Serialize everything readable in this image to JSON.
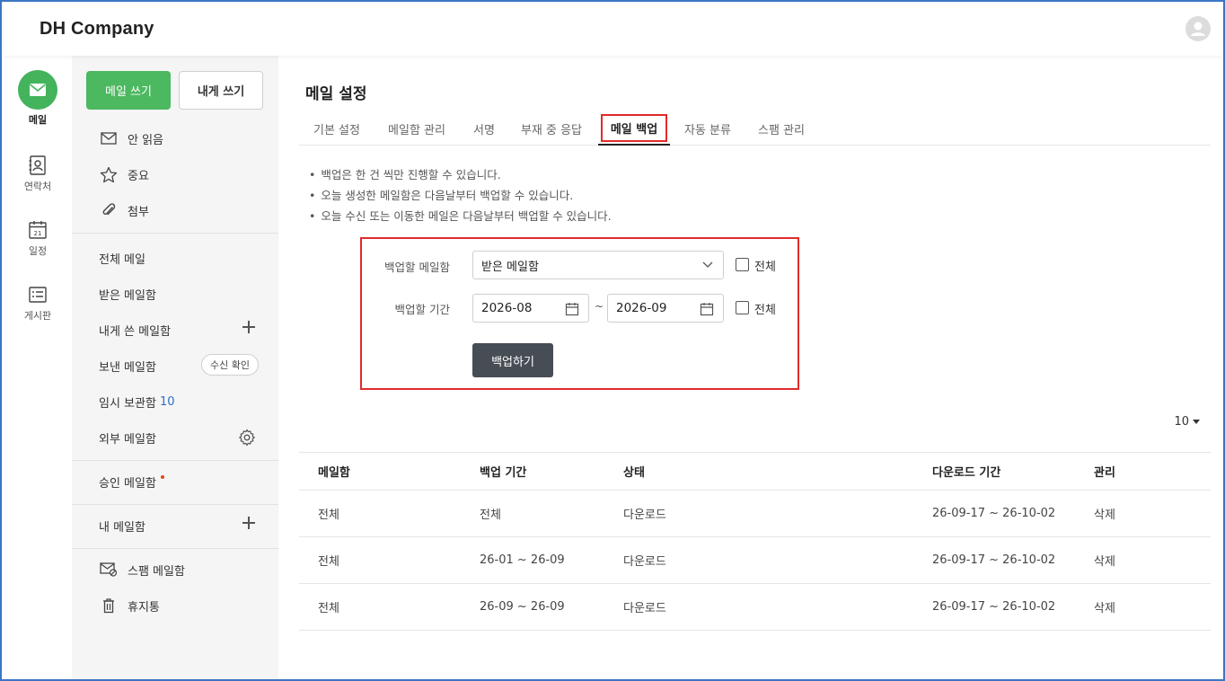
{
  "app": {
    "company": "DH Company"
  },
  "rail": {
    "items": [
      {
        "label": "메일",
        "icon": "mail-icon"
      },
      {
        "label": "연락처",
        "icon": "contacts-icon"
      },
      {
        "label": "일정",
        "icon": "calendar-icon",
        "day": "21"
      },
      {
        "label": "게시판",
        "icon": "board-icon"
      }
    ]
  },
  "sidebar": {
    "write_label": "메일 쓰기",
    "self_write_label": "내게 쓰기",
    "quick": [
      {
        "label": "안 읽음",
        "icon": "envelope-icon"
      },
      {
        "label": "중요",
        "icon": "star-icon"
      },
      {
        "label": "첨부",
        "icon": "paperclip-icon"
      }
    ],
    "folders": {
      "all": "전체 메일",
      "inbox": "받은 메일함",
      "self": "내게 쓴 메일함",
      "sent": "보낸 메일함",
      "sent_action": "수신 확인",
      "drafts": "임시 보관함",
      "drafts_count": "10",
      "external": "외부 메일함",
      "approval": "승인 메일함",
      "mine": "내 메일함",
      "spam": "스팸 메일함",
      "trash": "휴지통"
    }
  },
  "main": {
    "title": "메일 설정",
    "tabs": [
      "기본 설정",
      "메일함 관리",
      "서명",
      "부재 중 응답",
      "메일 백업",
      "자동 분류",
      "스팸 관리"
    ],
    "active_tab": "메일 백업",
    "notes": [
      "백업은 한 건 씩만 진행할 수 있습니다.",
      "오늘 생성한 메일함은 다음날부터 백업할 수 있습니다.",
      "오늘 수신 또는 이동한 메일은 다음날부터 백업할 수 있습니다."
    ],
    "form": {
      "mailbox_label": "백업할 메일함",
      "mailbox_value": "받은 메일함",
      "period_label": "백업할 기간",
      "start": "2026-08",
      "tilde": "~",
      "end": "2026-09",
      "all_label": "전체",
      "all_label2": "전체",
      "submit": "백업하기"
    },
    "page_size": "10",
    "table": {
      "headers": [
        "메일함",
        "백업 기간",
        "상태",
        "다운로드 기간",
        "관리"
      ],
      "rows": [
        [
          "전체",
          "전체",
          "다운로드",
          "26-09-17 ~ 26-10-02",
          "삭제"
        ],
        [
          "전체",
          "26-01 ~ 26-09",
          "다운로드",
          "26-09-17 ~ 26-10-02",
          "삭제"
        ],
        [
          "전체",
          "26-09 ~ 26-09",
          "다운로드",
          "26-09-17 ~ 26-10-02",
          "삭제"
        ]
      ]
    }
  },
  "colors": {
    "accent": "#4cb860",
    "highlight": "#e02b2b",
    "button_dark": "#474d55",
    "count": "#2a6fc9"
  }
}
